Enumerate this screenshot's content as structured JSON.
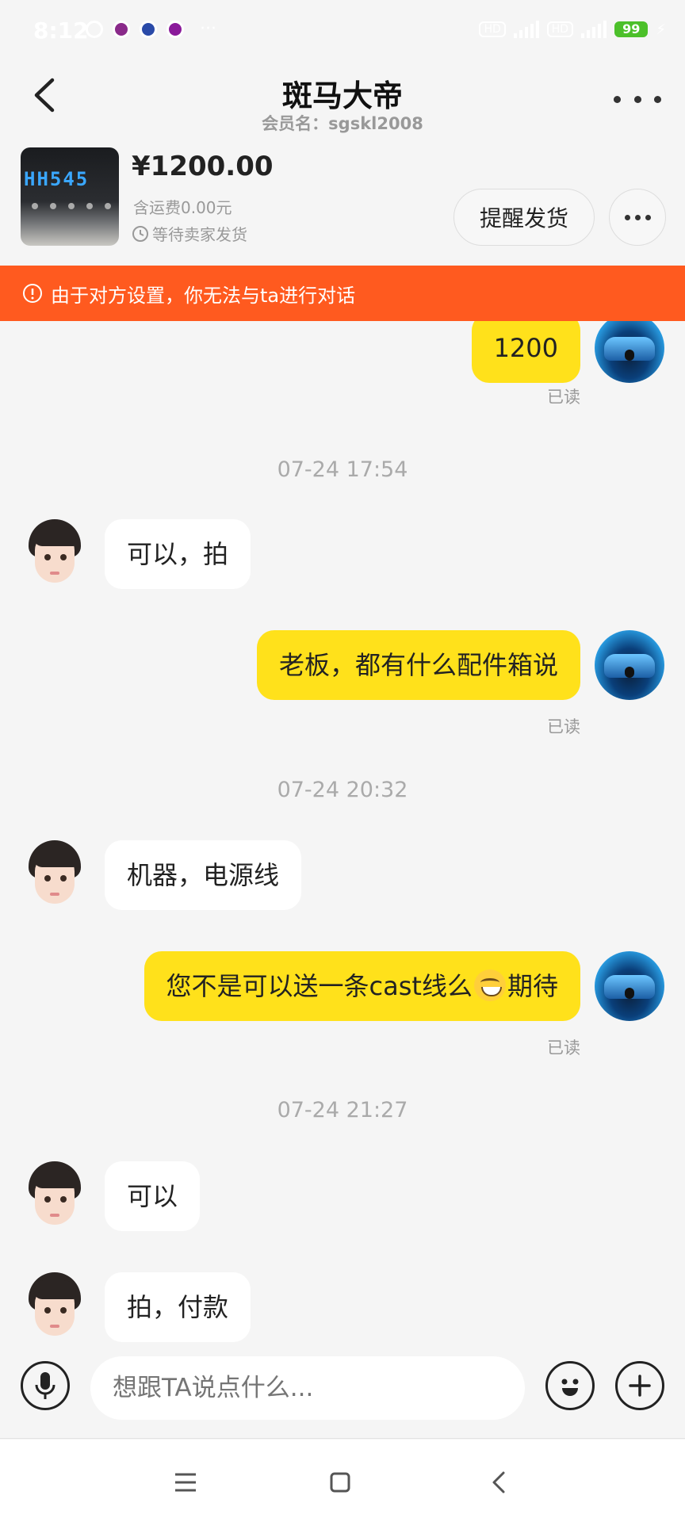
{
  "status_bar": {
    "time": "8:12",
    "battery": "99",
    "more": "···"
  },
  "header": {
    "title": "斑马大帝",
    "subtitle": "会员名：sgskl2008"
  },
  "product": {
    "price": "¥1200.00",
    "shipping": "含运费0.00元",
    "status": "等待卖家发货",
    "remind_label": "提醒发货",
    "lcd_text": "HH545"
  },
  "banner": {
    "text": "由于对方设置，你无法与ta进行对话"
  },
  "messages": [
    {
      "type": "msg",
      "from": "me",
      "text": "1200",
      "read": "已读"
    },
    {
      "type": "time",
      "text": "07-24 17:54"
    },
    {
      "type": "msg",
      "from": "them",
      "text": "可以，拍"
    },
    {
      "type": "msg",
      "from": "me",
      "text": "老板，都有什么配件箱说",
      "read": "已读"
    },
    {
      "type": "time",
      "text": "07-24 20:32"
    },
    {
      "type": "msg",
      "from": "them",
      "text": "机器，电源线"
    },
    {
      "type": "msg",
      "from": "me",
      "text_before": "您不是可以送一条cast线么",
      "emoji": "grinning-face-emoji",
      "text_after": "期待",
      "read": "已读"
    },
    {
      "type": "time",
      "text": "07-24 21:27"
    },
    {
      "type": "msg",
      "from": "them",
      "text": "可以"
    },
    {
      "type": "msg",
      "from": "them",
      "text": "拍，付款"
    }
  ],
  "input": {
    "placeholder": "想跟TA说点什么..."
  },
  "colors": {
    "accent_yellow": "#ffe11b",
    "banner_orange": "#ff5a1f",
    "background": "#f5f5f5"
  }
}
